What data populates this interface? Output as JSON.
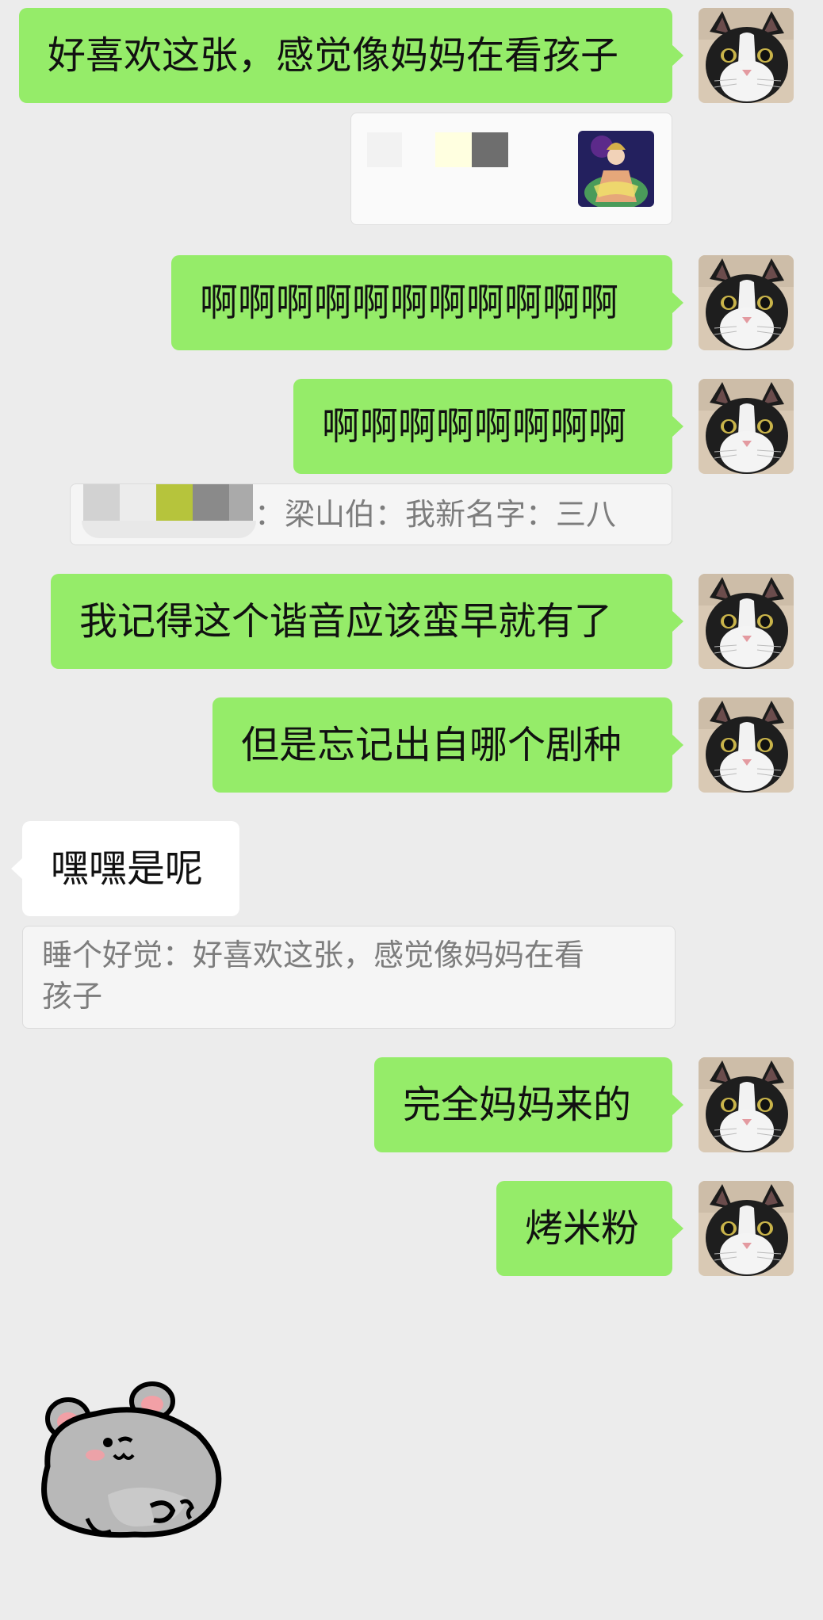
{
  "messages": [
    {
      "text": "好喜欢这张，感觉像妈妈在看孩子"
    },
    {
      "text": "啊啊啊啊啊啊啊啊啊啊啊"
    },
    {
      "text": "啊啊啊啊啊啊啊啊"
    },
    {
      "text": "我记得这个谐音应该蛮早就有了"
    },
    {
      "text": "但是忘记出自哪个剧种"
    },
    {
      "text": "嘿嘿是呢"
    },
    {
      "text": "完全妈妈来的"
    },
    {
      "text": "烤米粉"
    }
  ],
  "quotes": [
    {
      "text": "：梁山伯：我新名字：三八"
    },
    {
      "line1": "睡个好觉：好喜欢这张，感觉像妈妈在看",
      "line2": "孩子"
    }
  ],
  "icons": {
    "avatar": "cat-avatar-icon",
    "image_thumb": "opera-image-thumbnail",
    "sticker": "hamster-sticker-icon"
  },
  "colors": {
    "background": "#ececec",
    "outgoing_bubble": "#95ec69",
    "incoming_bubble": "#ffffff",
    "quote_text": "#7d7d7d"
  }
}
